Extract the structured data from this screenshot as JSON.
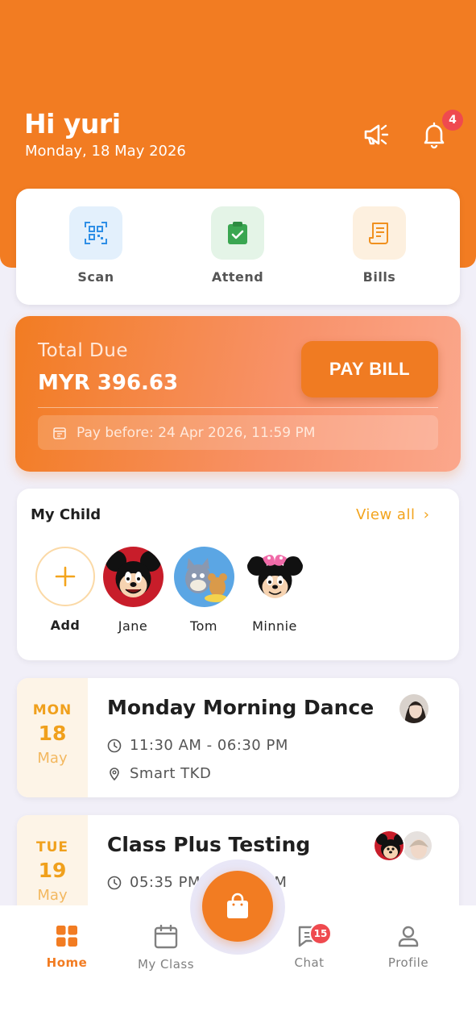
{
  "header": {
    "greeting": "Hi yuri",
    "date": "Monday, 18 May 2026",
    "notification_count": "4"
  },
  "quick_actions": [
    {
      "label": "Scan",
      "icon": "qr-scan-icon",
      "color": "#2f8fe6"
    },
    {
      "label": "Attend",
      "icon": "clipboard-check-icon",
      "color": "#3aa651"
    },
    {
      "label": "Bills",
      "icon": "receipt-icon",
      "color": "#f0901e"
    }
  ],
  "due": {
    "label": "Total Due",
    "amount": "MYR 396.63",
    "pay_button": "PAY BILL",
    "pay_before": "Pay before: 24 Apr 2026, 11:59 PM"
  },
  "children": {
    "title": "My Child",
    "view_all": "View all",
    "add_label": "Add",
    "items": [
      {
        "name": "Jane"
      },
      {
        "name": "Tom"
      },
      {
        "name": "Minnie"
      }
    ]
  },
  "classes": [
    {
      "day": "MON",
      "date": "18",
      "month": "May",
      "title": "Monday Morning Dance",
      "time": "11:30 AM - 06:30 PM",
      "location": "Smart TKD"
    },
    {
      "day": "TUE",
      "date": "19",
      "month": "May",
      "title": "Class Plus Testing",
      "time": "05:35 PM - 07:35 PM"
    }
  ],
  "nav": {
    "home": "Home",
    "my_class": "My Class",
    "chat": "Chat",
    "profile": "Profile",
    "chat_badge": "15"
  },
  "colors": {
    "brand": "#f27c22",
    "accent_yellow": "#f3a41d",
    "badge_red": "#ef4a4f"
  }
}
